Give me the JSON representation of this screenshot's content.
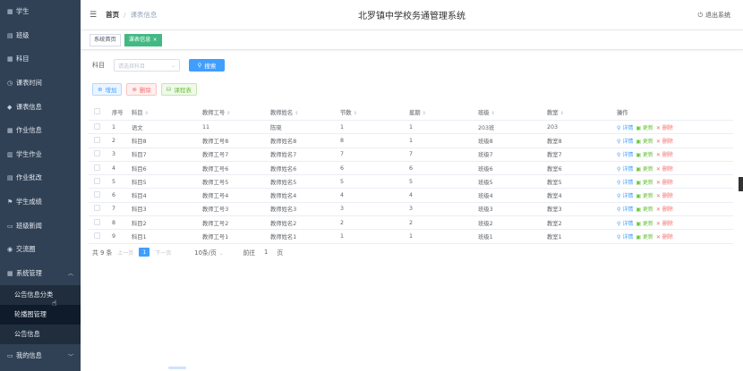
{
  "sidebar": {
    "items": [
      {
        "icon": "grid-icon",
        "glyph": "▦",
        "label": "学生"
      },
      {
        "icon": "briefcase-icon",
        "glyph": "▤",
        "label": "班级"
      },
      {
        "icon": "grid-icon",
        "glyph": "▦",
        "label": "科目"
      },
      {
        "icon": "clock-icon",
        "glyph": "◷",
        "label": "课表时间"
      },
      {
        "icon": "user-icon",
        "glyph": "◆",
        "label": "课表信息"
      },
      {
        "icon": "grid-icon",
        "glyph": "▦",
        "label": "作业信息"
      },
      {
        "icon": "chart-icon",
        "glyph": "▥",
        "label": "学生作业"
      },
      {
        "icon": "file-icon",
        "glyph": "▤",
        "label": "作业批改"
      },
      {
        "icon": "flag-icon",
        "glyph": "⚑",
        "label": "学生成绩"
      },
      {
        "icon": "browser-icon",
        "glyph": "▭",
        "label": "班级新闻"
      },
      {
        "icon": "chat-icon",
        "glyph": "◉",
        "label": "交流圈"
      },
      {
        "icon": "grid-icon",
        "glyph": "▦",
        "label": "系统管理",
        "arrow": "︿"
      }
    ],
    "sub_items": [
      "公告信息分类",
      "轮播图管理",
      "公告信息"
    ],
    "last_item": {
      "icon": "id-card-icon",
      "glyph": "▭",
      "label": "我的信息",
      "arrow": "﹀"
    }
  },
  "header": {
    "breadcrumb_home": "首页",
    "breadcrumb_current": "课表信息",
    "title": "北罗镇中学校务通管理系统",
    "logout": "退出系统"
  },
  "tags": {
    "home": "系统首页",
    "active": "课表信息",
    "close": "×"
  },
  "search": {
    "label": "科目",
    "placeholder": "请选择科目",
    "button": "搜索"
  },
  "actions": {
    "add": "增加",
    "delete": "删除",
    "schedule": "课程表"
  },
  "table": {
    "columns": [
      "序号",
      "科目",
      "教师工号",
      "教师姓名",
      "节数",
      "星期",
      "班级",
      "教室",
      "操作"
    ],
    "op_detail": "详情",
    "op_edit": "更新",
    "op_delete": "删除",
    "rows": [
      [
        "1",
        "语文",
        "11",
        "陈晓",
        "1",
        "1",
        "203班",
        "203"
      ],
      [
        "2",
        "科目8",
        "教师工号8",
        "教师姓名8",
        "8",
        "1",
        "班级8",
        "教室8"
      ],
      [
        "3",
        "科目7",
        "教师工号7",
        "教师姓名7",
        "7",
        "7",
        "班级7",
        "教室7"
      ],
      [
        "4",
        "科目6",
        "教师工号6",
        "教师姓名6",
        "6",
        "6",
        "班级6",
        "教室6"
      ],
      [
        "5",
        "科目5",
        "教师工号5",
        "教师姓名5",
        "5",
        "5",
        "班级5",
        "教室5"
      ],
      [
        "6",
        "科目4",
        "教师工号4",
        "教师姓名4",
        "4",
        "4",
        "班级4",
        "教室4"
      ],
      [
        "7",
        "科目3",
        "教师工号3",
        "教师姓名3",
        "3",
        "3",
        "班级3",
        "教室3"
      ],
      [
        "8",
        "科目2",
        "教师工号2",
        "教师姓名2",
        "2",
        "2",
        "班级2",
        "教室2"
      ],
      [
        "9",
        "科目1",
        "教师工号1",
        "教师姓名1",
        "1",
        "1",
        "班级1",
        "教室1"
      ]
    ]
  },
  "pagination": {
    "total": "共 9 条",
    "prev": "上一页",
    "page": "1",
    "next": "下一页",
    "page_size": "10条/页",
    "goto": "前往",
    "goto_value": "1",
    "unit": "页"
  }
}
